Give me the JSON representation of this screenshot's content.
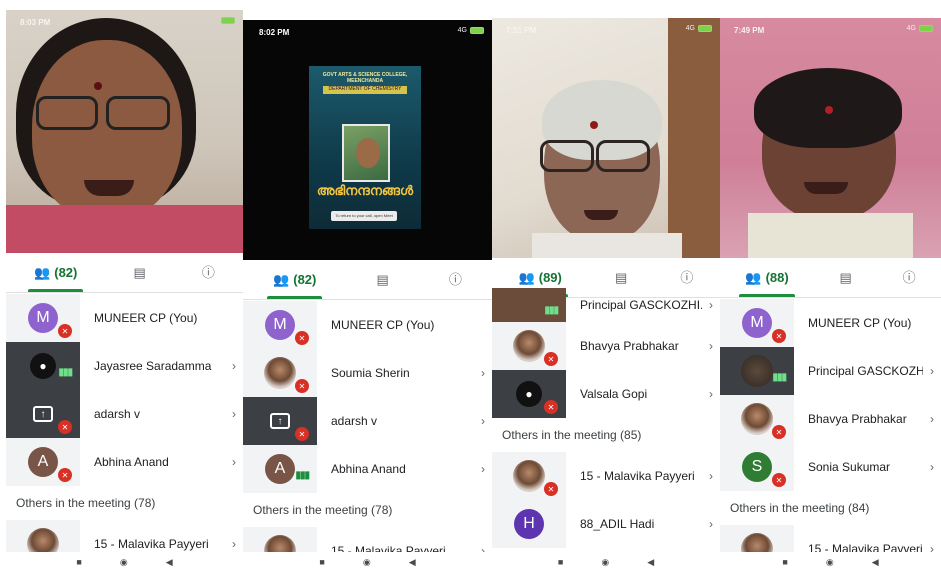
{
  "panels": [
    {
      "time": "8:03 PM",
      "tabs": {
        "people": "(82)"
      },
      "participants": [
        {
          "name": "MUNEER CP (You)",
          "avatar": "M",
          "color": "#8e63ce"
        },
        {
          "name": "Jayasree Saradamma"
        },
        {
          "name": "adarsh v"
        },
        {
          "name": "Abhina Anand",
          "avatar": "A",
          "color": "#795548"
        }
      ],
      "others_heading": "Others in the meeting (78)",
      "others": [
        {
          "name": "15 - Malavika Payyeri"
        }
      ]
    },
    {
      "time": "8:02 PM",
      "signal": "4G",
      "tabs": {
        "people": "(82)"
      },
      "poster": {
        "college": "GOVT ARTS & SCIENCE COLLEGE, MEENCHANDA",
        "department": "DEPARTMENT OF CHEMISTRY",
        "title": "അഭിനന്ദനങ്ങൾ",
        "button": "To return to your call, open Meet"
      },
      "participants": [
        {
          "name": "MUNEER CP (You)",
          "avatar": "M",
          "color": "#8e63ce"
        },
        {
          "name": "Soumia Sherin"
        },
        {
          "name": "adarsh v"
        },
        {
          "name": "Abhina Anand",
          "avatar": "A",
          "color": "#795548"
        }
      ],
      "others_heading": "Others in the meeting (78)",
      "others": [
        {
          "name": "15 - Malavika Payyeri"
        }
      ]
    },
    {
      "time": "7:51 PM",
      "signal": "4G",
      "tabs": {
        "people": "(89)"
      },
      "participants": [
        {
          "name": "Principal GASCKOZHI..."
        },
        {
          "name": "Bhavya Prabhakar"
        },
        {
          "name": "Valsala Gopi"
        }
      ],
      "others_heading": "Others in the meeting (85)",
      "others": [
        {
          "name": "15 - Malavika Payyeri"
        },
        {
          "name": "88_ADIL Hadi",
          "avatar": "H",
          "color": "#5e35b1"
        }
      ]
    },
    {
      "time": "7:49 PM",
      "signal": "4G",
      "tabs": {
        "people": "(88)"
      },
      "participants": [
        {
          "name": "MUNEER CP (You)",
          "avatar": "M",
          "color": "#8e63ce"
        },
        {
          "name": "Principal GASCKOZHI..."
        },
        {
          "name": "Bhavya Prabhakar"
        },
        {
          "name": "Sonia Sukumar",
          "avatar": "S",
          "color": "#2e7d32"
        }
      ],
      "others_heading": "Others in the meeting (84)",
      "others": [
        {
          "name": "15 - Malavika Payyeri"
        }
      ]
    }
  ],
  "icons": {
    "people": "people-icon",
    "chat": "chat-icon",
    "info": "info-icon",
    "mic_off": "mic-off-icon",
    "chevron": "chevron-right-icon",
    "nav": [
      "square-nav-icon",
      "circle-nav-icon",
      "back-triangle-icon"
    ]
  },
  "colors": {
    "accent_green": "#1e8e3e",
    "mute_red": "#d93025"
  }
}
